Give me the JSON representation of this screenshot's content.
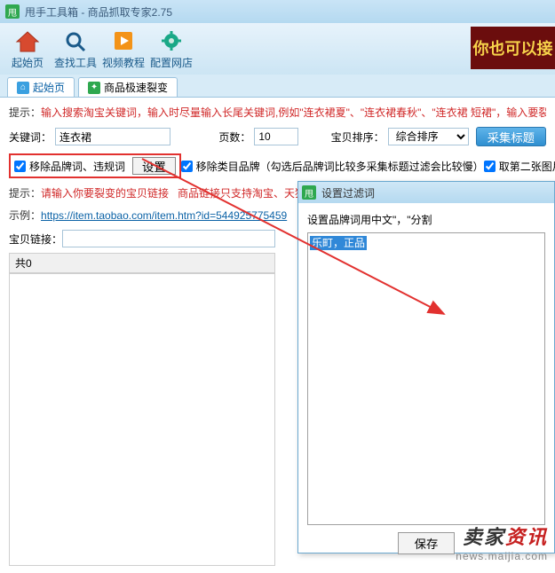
{
  "window": {
    "title": "甩手工具箱 - 商品抓取专家2.75",
    "logo": "甩"
  },
  "toolbar": {
    "items": [
      {
        "label": "起始页",
        "icon": "home"
      },
      {
        "label": "查找工具",
        "icon": "search"
      },
      {
        "label": "视频教程",
        "icon": "play"
      },
      {
        "label": "配置网店",
        "icon": "gear"
      }
    ],
    "banner": "你也可以接"
  },
  "tabs": [
    {
      "label": "起始页",
      "icon": "home"
    },
    {
      "label": "商品极速裂变",
      "icon": "split"
    }
  ],
  "hint1": {
    "label": "提示：",
    "text": "输入搜索淘宝关键词，输入时尽量输入长尾关键词,例如\"连衣裙夏\"、\"连衣裙春秋\"、\"连衣裙 短裙\"，输入要裂变淘宝链"
  },
  "form": {
    "kw_label": "关键词：",
    "kw_value": "连衣裙",
    "pg_label": "页数：",
    "pg_value": "10",
    "sort_label": "宝贝排序：",
    "sort_value": "综合排序",
    "collect_btn": "采集标题"
  },
  "filters": {
    "chk1": "移除品牌词、违规词",
    "set_btn": "设置",
    "chk2": "移除类目品牌（勾选后品牌词比较多采集标题过滤会比较慢）",
    "chk3": "取第二张图片作为"
  },
  "hint2": {
    "label": "提示：",
    "t1": "请输入你要裂变的宝贝链接",
    "t2": "商品链接只支持淘宝、天猫"
  },
  "example": {
    "label": "示例：",
    "url": "https://item.taobao.com/item.htm?id=544925775459"
  },
  "linkrow": {
    "label": "宝贝链接："
  },
  "count": {
    "label": "共",
    "value": "0"
  },
  "dialog": {
    "title": "设置过滤词",
    "logo": "甩",
    "hint": "设置品牌词用中文\"，\"分割",
    "content": "乐町，正品",
    "save": "保存"
  },
  "watermark": {
    "line1a": "卖家",
    "line1b": "资讯",
    "line2": "news.maijia.com"
  }
}
